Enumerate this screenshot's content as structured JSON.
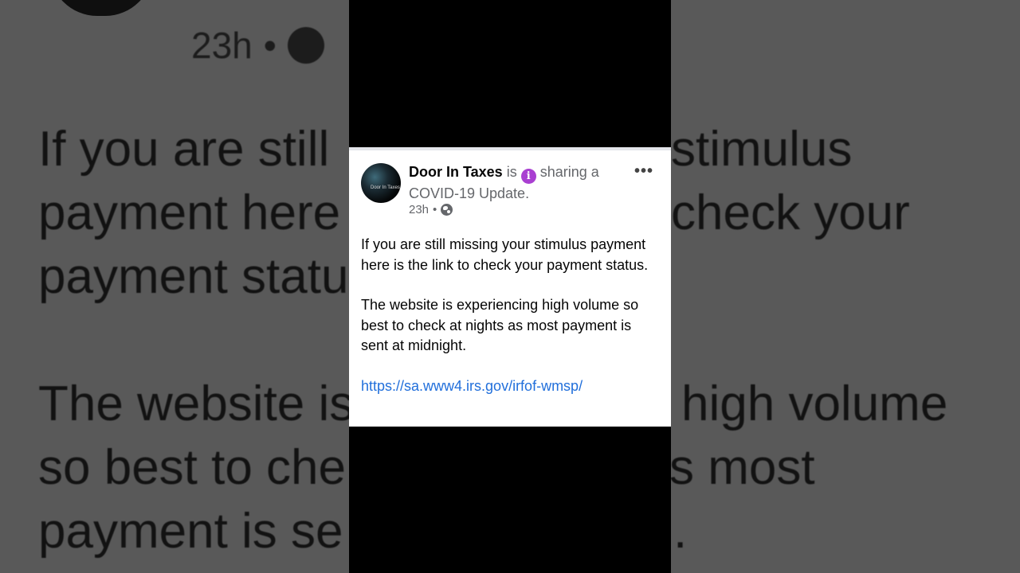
{
  "background": {
    "meta_time": "23h",
    "meta_dot": "•",
    "paragraph1_lines": [
      "If you are still",
      "payment here",
      "payment statu"
    ],
    "paragraph1_right": [
      "stimulus",
      "check your"
    ],
    "paragraph2_lines": [
      "The website is",
      "so best to che",
      "payment is se"
    ],
    "paragraph2_right": [
      "high volume",
      "s most",
      "."
    ]
  },
  "post": {
    "author": "Door In Taxes",
    "verb": "is",
    "activity": "sharing a",
    "activity_line2": "COVID-19 Update.",
    "time": "23h",
    "separator": "•",
    "paragraph1": "If you are still missing your stimulus payment here is the link to check your payment status.",
    "paragraph2": "The website is experiencing high volume so best to check at nights as most payment is sent at midnight.",
    "link": "https://sa.www4.irs.gov/irfof-wmsp/",
    "more_label": "•••",
    "avatar_label": "Door In Taxes",
    "info_icon_glyph": "i"
  },
  "icons": {
    "info": "info-icon",
    "globe": "globe-icon",
    "more": "more-icon"
  },
  "colors": {
    "link": "#216fdb",
    "info_badge": "#a93fd1",
    "text_secondary": "#65676b"
  }
}
